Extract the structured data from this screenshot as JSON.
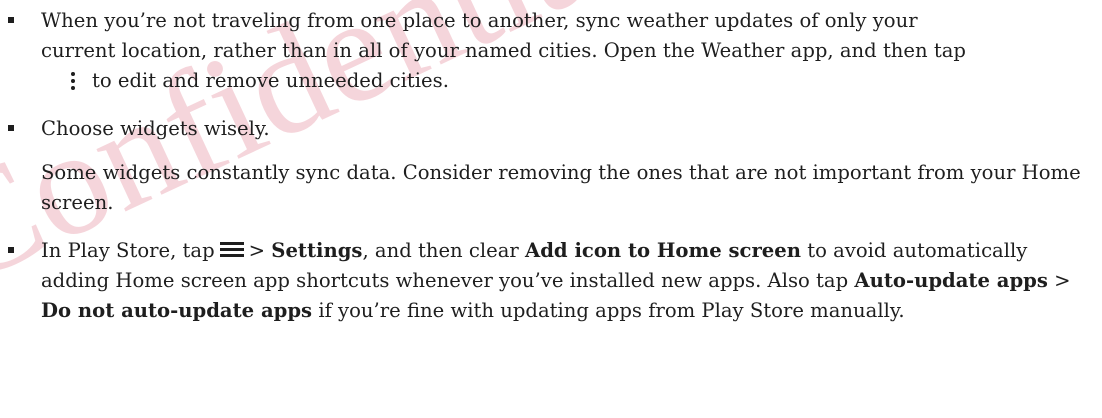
{
  "watermark": {
    "text": "Confidential Certification",
    "color": "#c8102e"
  },
  "items": [
    {
      "line1": "When you’re not traveling from one place to another, sync weather updates of only your",
      "line2": "current location, rather than in all of your named cities. Open the Weather app, and then tap",
      "icon": "more-vertical-icon",
      "line3": "to edit and remove unneeded cities."
    },
    {
      "text": "Choose widgets wisely.",
      "para": "Some widgets constantly sync data. Consider removing the ones that are not important from your Home screen."
    },
    {
      "prefix": "In Play Store, tap",
      "icon": "menu-icon",
      "sep1": ">",
      "settings": "Settings",
      "mid1": ", and then clear",
      "add_icon": "Add icon to Home screen",
      "mid2": "to avoid automatically adding Home screen app shortcuts whenever you’ve installed new apps. Also tap",
      "auto_update": "Auto-update apps",
      "sep2": ">",
      "do_not": "Do not auto-update apps",
      "suffix": "if you’re fine with updating apps from Play Store manually."
    }
  ]
}
